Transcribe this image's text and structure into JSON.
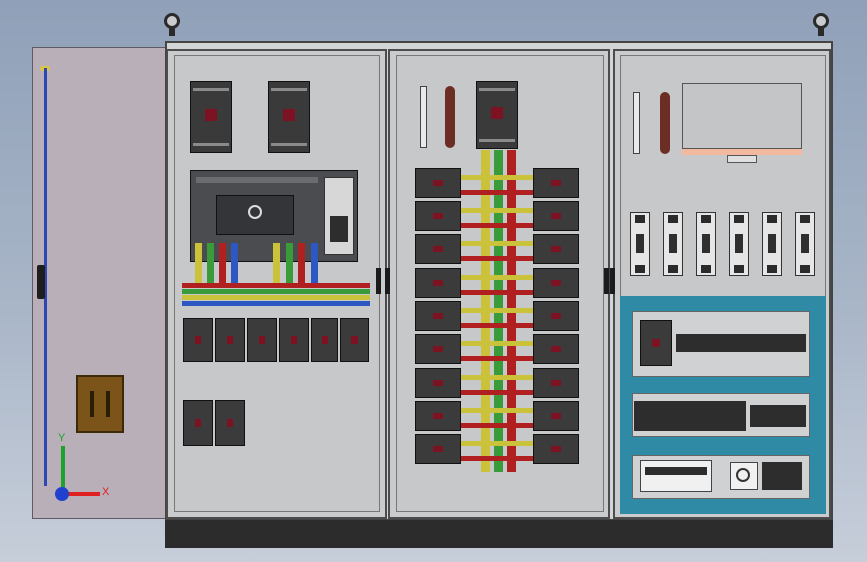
{
  "view": {
    "axis_labels": {
      "x": "X",
      "y": "Y"
    }
  },
  "colors": {
    "phase_a": "#c9c23a",
    "phase_b": "#3a9b3a",
    "phase_c": "#b02020",
    "neutral": "#2f57c4",
    "accent_teal": "#2f8aa6"
  },
  "icons": [
    "lifting-eye-icon",
    "door-lock-icon",
    "coordinate-axes-icon"
  ]
}
